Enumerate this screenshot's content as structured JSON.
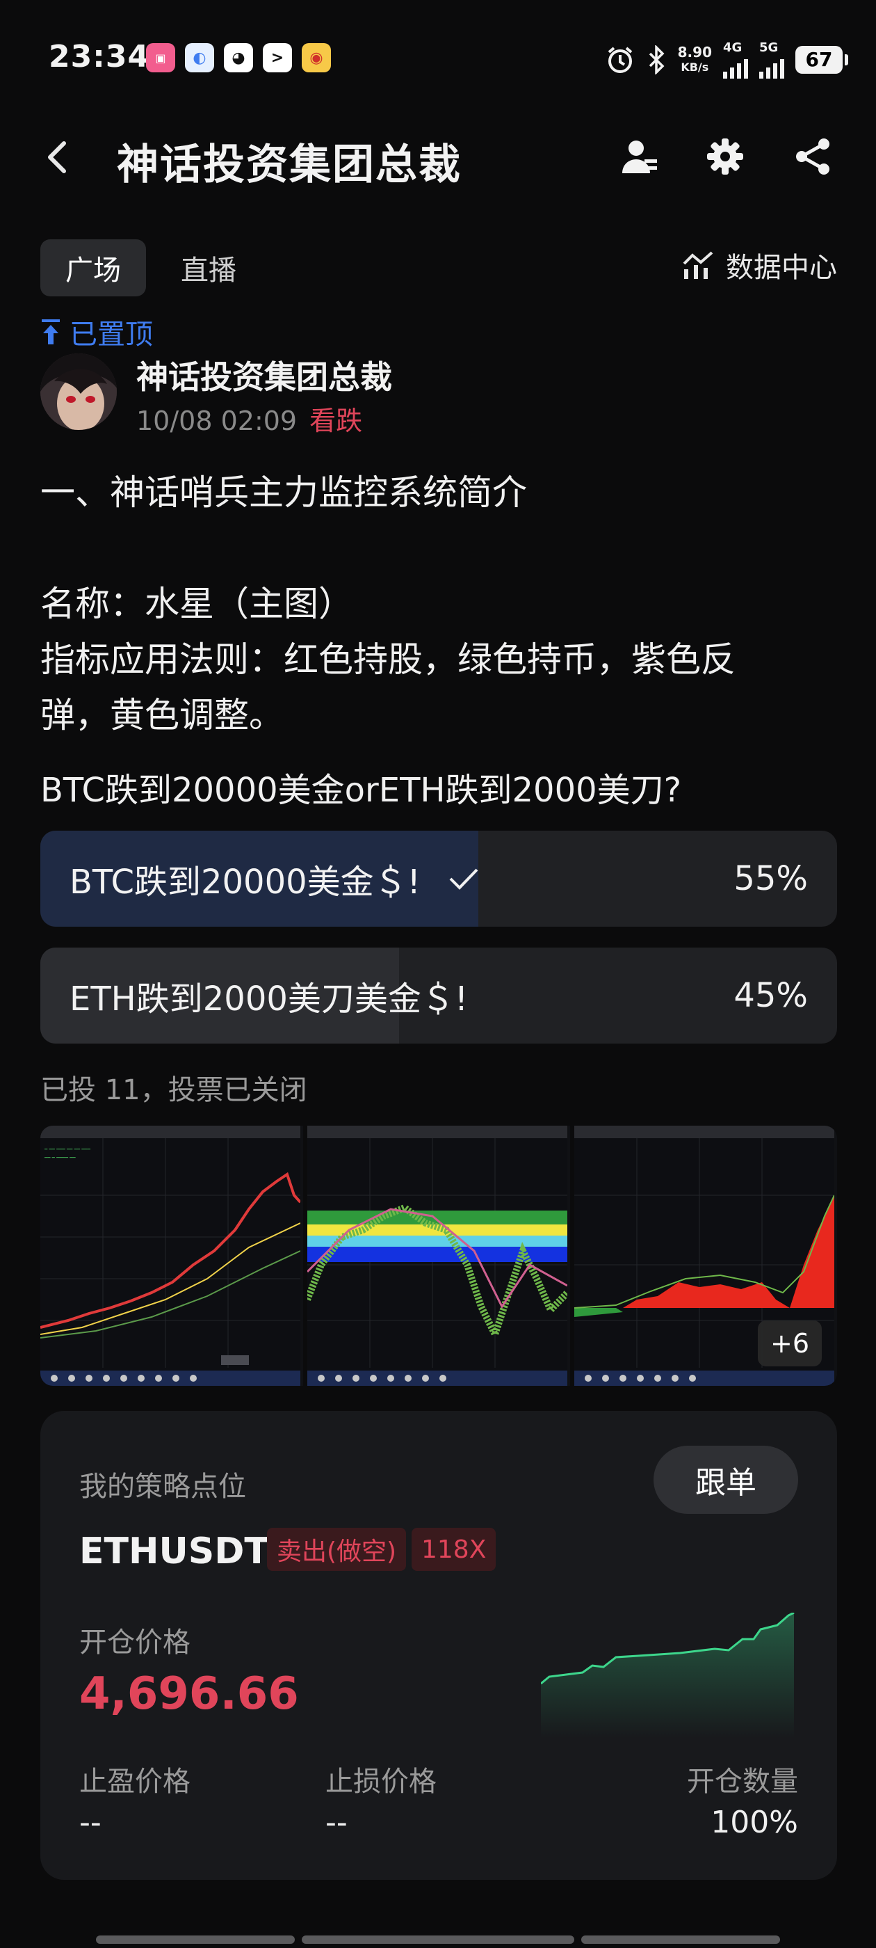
{
  "status_bar": {
    "time": "23:34",
    "net_speed": "8.90",
    "net_unit": "KB/s",
    "signal1": "4G",
    "signal2": "5G",
    "battery": "67"
  },
  "header": {
    "title": "神话投资集团总裁"
  },
  "tabs": [
    {
      "label": "广场"
    },
    {
      "label": "直播"
    }
  ],
  "data_center": "数据中心",
  "post": {
    "pinned": "已置顶",
    "author": "神话投资集团总裁",
    "datetime": "10/08 02:09",
    "sentiment": "看跌",
    "lines": [
      "一、神话哨兵主力监控系统简介",
      "",
      "名称：水星（主图）",
      "指标应用法则：红色持股，绿色持币，紫色反",
      "弹，黄色调整。"
    ],
    "question": "BTC跌到20000美金orETH跌到2000美刀?",
    "poll": [
      {
        "label": "BTC跌到20000美金＄!",
        "percent": "55%",
        "share": 0.55,
        "selected": true
      },
      {
        "label": "ETH跌到2000美刀美金＄!",
        "percent": "45%",
        "share": 0.45,
        "selected": false
      }
    ],
    "vote_status": "已投 11，投票已关闭",
    "more_images": "+6"
  },
  "strategy": {
    "label": "我的策略点位",
    "follow_button": "跟单",
    "symbol": "ETHUSDT",
    "side": "卖出(做空)",
    "leverage": "118X",
    "open_price_label": "开仓价格",
    "open_price": "4,696.66",
    "take_profit_label": "止盈价格",
    "take_profit": "--",
    "stop_loss_label": "止损价格",
    "stop_loss": "--",
    "size_label": "开仓数量",
    "size": "100%"
  },
  "colors": {
    "accent_blue": "#3f7cf0",
    "bear_red": "#e0455a",
    "spark_green": "#3dd68c"
  }
}
